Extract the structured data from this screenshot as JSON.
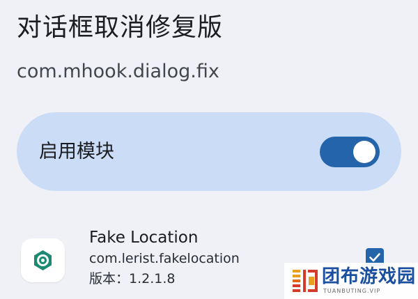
{
  "module": {
    "title": "对话框取消修复版",
    "package": "com.mhook.dialog.fix"
  },
  "enable": {
    "label": "启用模块",
    "state": "on"
  },
  "colors": {
    "background": "#eff1f7",
    "card": "#cbdcf6",
    "accent": "#2364aa",
    "app_icon_green": "#1c8a72"
  },
  "apps": [
    {
      "name": "Fake Location",
      "package": "com.lerist.fakelocation",
      "version": "版本：1.2.1.8",
      "checked": true,
      "icon": "location-target-icon"
    }
  ],
  "watermark": {
    "text": "团布游戏园",
    "sub": "TUANBUTING.VIP"
  }
}
